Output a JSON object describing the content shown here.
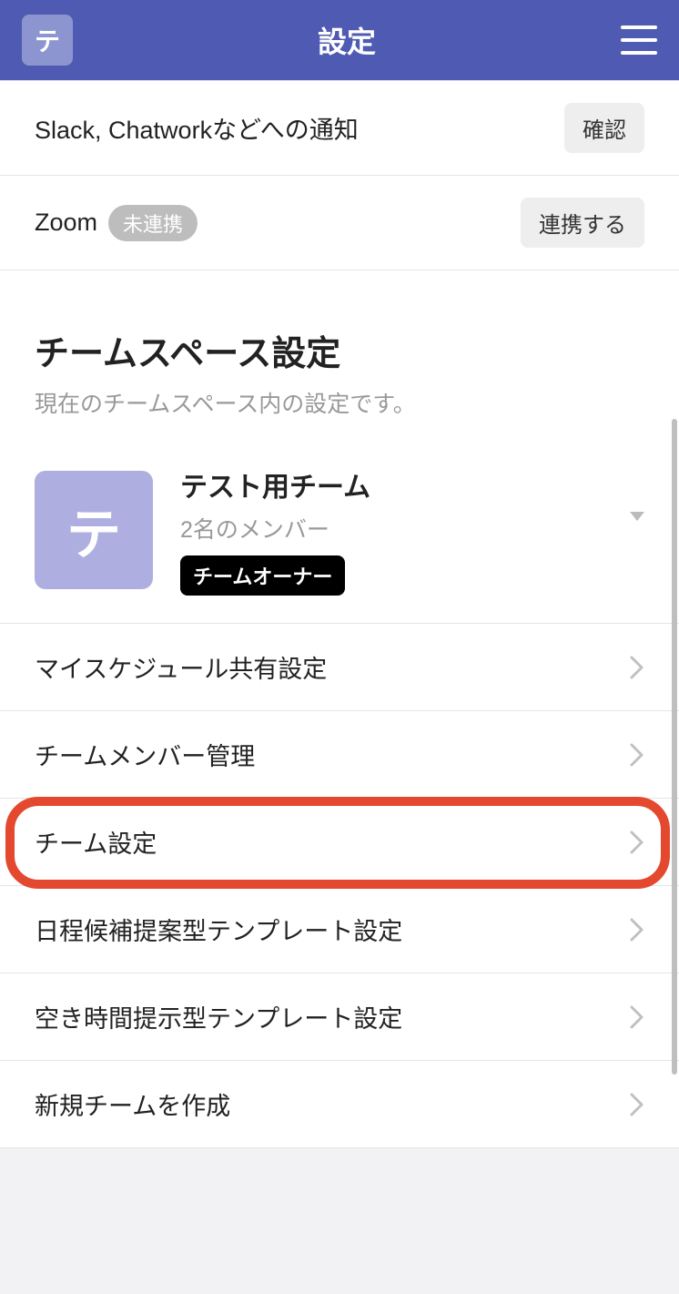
{
  "header": {
    "avatar_letter": "テ",
    "title": "設定"
  },
  "integrations": [
    {
      "label": "Slack, Chatworkなどへの通知",
      "action": "確認",
      "status": null
    },
    {
      "label": "Zoom",
      "action": "連携する",
      "status": "未連携"
    }
  ],
  "section": {
    "title": "チームスペース設定",
    "subtitle": "現在のチームスペース内の設定です。"
  },
  "team": {
    "avatar_letter": "テ",
    "name": "テスト用チーム",
    "members": "2名のメンバー",
    "role": "チームオーナー"
  },
  "nav": [
    {
      "label": "マイスケジュール共有設定",
      "highlighted": false
    },
    {
      "label": "チームメンバー管理",
      "highlighted": false
    },
    {
      "label": "チーム設定",
      "highlighted": true
    },
    {
      "label": "日程候補提案型テンプレート設定",
      "highlighted": false
    },
    {
      "label": "空き時間提示型テンプレート設定",
      "highlighted": false
    },
    {
      "label": "新規チームを作成",
      "highlighted": false
    }
  ],
  "colors": {
    "header_bg": "#4f5bb3",
    "avatar_bg": "#aeaee0",
    "highlight": "#e4492f"
  }
}
